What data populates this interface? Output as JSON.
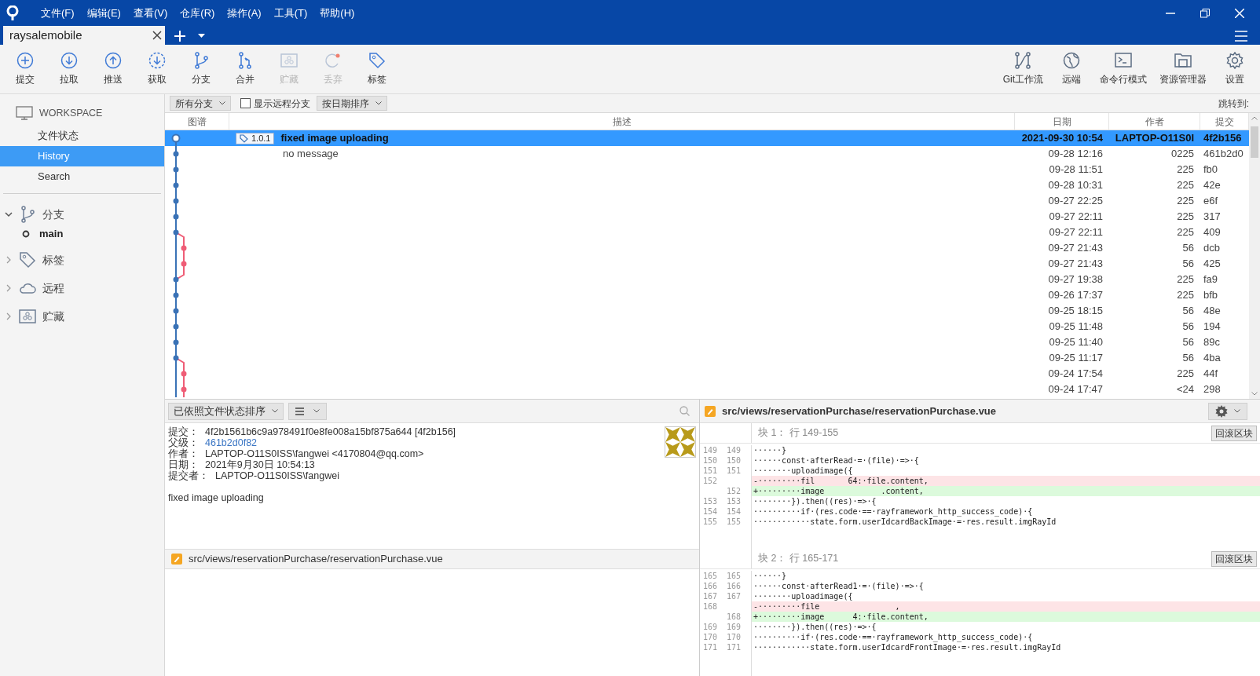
{
  "menu": [
    "文件(F)",
    "编辑(E)",
    "查看(V)",
    "仓库(R)",
    "操作(A)",
    "工具(T)",
    "帮助(H)"
  ],
  "tab": {
    "label": "raysalemobile"
  },
  "toolbar_left": [
    {
      "label": "提交",
      "kind": "plus",
      "disabled": false
    },
    {
      "label": "拉取",
      "kind": "down",
      "disabled": false
    },
    {
      "label": "推送",
      "kind": "up",
      "disabled": false
    },
    {
      "label": "获取",
      "kind": "fetch",
      "disabled": false
    },
    {
      "label": "分支",
      "kind": "branch",
      "disabled": false
    },
    {
      "label": "合并",
      "kind": "merge",
      "disabled": false
    },
    {
      "label": "贮藏",
      "kind": "stash",
      "disabled": true
    },
    {
      "label": "丢弃",
      "kind": "discard",
      "disabled": true
    },
    {
      "label": "标签",
      "kind": "tag",
      "disabled": false
    }
  ],
  "toolbar_right": [
    {
      "label": "Git工作流",
      "kind": "flow",
      "disabled": false
    },
    {
      "label": "远端",
      "kind": "globe",
      "disabled": false
    },
    {
      "label": "命令行模式",
      "kind": "terminal",
      "disabled": false
    },
    {
      "label": "资源管理器",
      "kind": "folder",
      "disabled": false
    },
    {
      "label": "设置",
      "kind": "gear",
      "disabled": false
    }
  ],
  "sidebar": {
    "workspace": "WORKSPACE",
    "items": [
      {
        "label": "文件状态",
        "selected": false
      },
      {
        "label": "History",
        "selected": true
      },
      {
        "label": "Search",
        "selected": false
      }
    ],
    "sections": [
      {
        "label": "分支",
        "kind": "branch",
        "expanded": true,
        "children": [
          {
            "label": "main"
          }
        ]
      },
      {
        "label": "标签",
        "kind": "tag",
        "expanded": false
      },
      {
        "label": "远程",
        "kind": "cloud",
        "expanded": false
      },
      {
        "label": "贮藏",
        "kind": "stash",
        "expanded": false
      }
    ]
  },
  "filters": {
    "branches": "所有分支",
    "remote_checkbox": {
      "label": "显示远程分支",
      "checked": false
    },
    "sort": "按日期排序",
    "jump": "跳转到:"
  },
  "table": {
    "columns": [
      "图谱",
      "描述",
      "日期",
      "作者",
      "提交"
    ],
    "rows": [
      {
        "kind": "main",
        "tag": "1.0.1",
        "description": "fixed image uploading",
        "date": "2021-09-30 10:54",
        "author": "LAPTOP-O11S0I",
        "commit": "4f2b156",
        "selected": true
      },
      {
        "kind": "main",
        "description": "no message",
        "date": "09-28 12:16",
        "author": "0225",
        "commit": "461b2d0",
        "selected": false
      },
      {
        "kind": "main",
        "date": "09-28 11:51",
        "author": "225",
        "commit": "fb0",
        "selected": false
      },
      {
        "kind": "main",
        "date": "09-28 10:31",
        "author": "225",
        "commit": "42e",
        "selected": false
      },
      {
        "kind": "main",
        "date": "09-27 22:25",
        "author": "225",
        "commit": "e6f",
        "selected": false
      },
      {
        "kind": "main",
        "date": "09-27 22:11",
        "author": "225",
        "commit": "317",
        "selected": false
      },
      {
        "kind": "main",
        "date": "09-27 22:11",
        "author": "225",
        "commit": "409",
        "selected": false
      },
      {
        "kind": "side",
        "date": "09-27 21:43",
        "author": "56",
        "commit": "dcb",
        "selected": false
      },
      {
        "kind": "side",
        "date": "09-27 21:43",
        "author": "56",
        "commit": "425",
        "selected": false
      },
      {
        "kind": "main",
        "date": "09-27 19:38",
        "author": "225",
        "commit": "fa9",
        "selected": false
      },
      {
        "kind": "main",
        "date": "09-26 17:37",
        "author": "225",
        "commit": "bfb",
        "selected": false
      },
      {
        "kind": "main",
        "date": "09-25 18:15",
        "author": "56",
        "commit": "48e",
        "selected": false
      },
      {
        "kind": "main",
        "date": "09-25 11:48",
        "author": "56",
        "commit": "194",
        "selected": false
      },
      {
        "kind": "main",
        "date": "09-25 11:40",
        "author": "56",
        "commit": "89c",
        "selected": false
      },
      {
        "kind": "main",
        "date": "09-25 11:17",
        "author": "56",
        "commit": "4ba",
        "selected": false
      },
      {
        "kind": "side",
        "date": "09-24 17:54",
        "author": "225",
        "commit": "44f",
        "selected": false
      },
      {
        "kind": "side",
        "date": "09-24 17:47",
        "author": "<24",
        "commit": "298",
        "selected": false
      }
    ]
  },
  "details": {
    "sort": "已依照文件状态排序",
    "fields": [
      {
        "label": "提交：",
        "value": "4f2b1561b6c9a978491f0e8fe008a15bf875a644 [4f2b156]",
        "kind": "text"
      },
      {
        "label": "父级：",
        "value": "461b2d0f82",
        "kind": "link"
      },
      {
        "label": "作者：",
        "value": "LAPTOP-O11S0ISS\\fangwei <4170804@qq.com>",
        "kind": "text"
      },
      {
        "label": "日期：",
        "value": "2021年9月30日 10:54:13",
        "kind": "text"
      },
      {
        "label": "提交者：",
        "value": "LAPTOP-O11S0ISS\\fangwei",
        "kind": "text"
      }
    ],
    "message": "fixed image uploading",
    "files": [
      "src/views/reservationPurchase/reservationPurchase.vue"
    ]
  },
  "diff": {
    "file": "src/views/reservationPurchase/reservationPurchase.vue",
    "hunks": [
      {
        "title": "块 1： 行 149-155",
        "button": "回滚区块",
        "lines": [
          {
            "kind": "context",
            "old": "149",
            "new": "149",
            "text": "······}"
          },
          {
            "kind": "context",
            "old": "150",
            "new": "150",
            "text": "······const·afterRead·=·(file)·=>·{"
          },
          {
            "kind": "context",
            "old": "151",
            "new": "151",
            "text": "········uploadimage({"
          },
          {
            "kind": "removed",
            "old": "152",
            "text": "-·········fil       64:·file.content,"
          },
          {
            "kind": "added",
            "new": "152",
            "text": "+·········image            .content,"
          },
          {
            "kind": "context",
            "old": "153",
            "new": "153",
            "text": "········}).then((res)·=>·{"
          },
          {
            "kind": "context",
            "old": "154",
            "new": "154",
            "text": "··········if·(res.code·==·rayframework_http_success_code)·{"
          },
          {
            "kind": "context",
            "old": "155",
            "new": "155",
            "text": "············state.form.userIdcardBackImage·=·res.result.imgRayId"
          }
        ]
      },
      {
        "title": "块 2： 行 165-171",
        "button": "回滚区块",
        "lines": [
          {
            "kind": "context",
            "old": "165",
            "new": "165",
            "text": "······}"
          },
          {
            "kind": "context",
            "old": "166",
            "new": "166",
            "text": "······const·afterRead1·=·(file)·=>·{"
          },
          {
            "kind": "context",
            "old": "167",
            "new": "167",
            "text": "········uploadimage({"
          },
          {
            "kind": "removed",
            "old": "168",
            "text": "-·········file                ,"
          },
          {
            "kind": "added",
            "new": "168",
            "text": "+·········image      4:·file.content,"
          },
          {
            "kind": "context",
            "old": "169",
            "new": "169",
            "text": "········}).then((res)·=>·{"
          },
          {
            "kind": "context",
            "old": "170",
            "new": "170",
            "text": "··········if·(res.code·==·rayframework_http_success_code)·{"
          },
          {
            "kind": "context",
            "old": "171",
            "new": "171",
            "text": "············state.form.userIdcardFrontImage·=·res.result.imgRayId"
          }
        ]
      }
    ]
  }
}
